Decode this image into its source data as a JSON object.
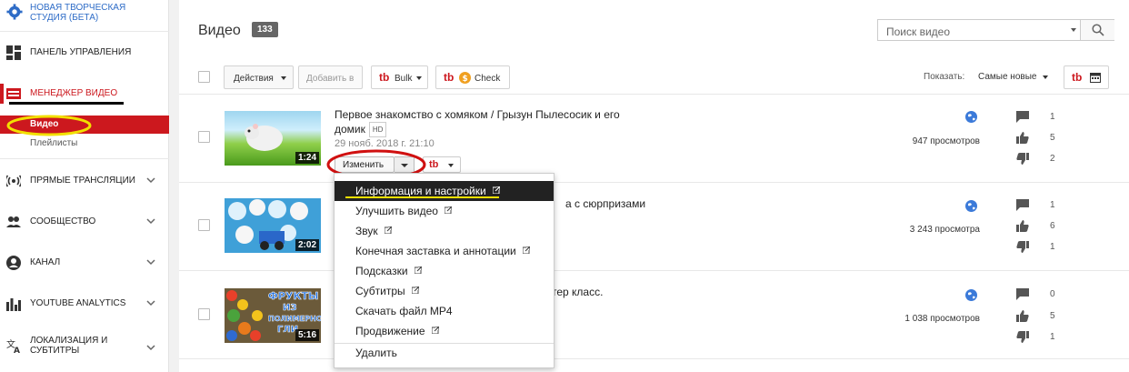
{
  "sidebar": {
    "studio_line1": "НОВАЯ ТВОРЧЕСКАЯ",
    "studio_line2": "СТУДИЯ (БЕТА)",
    "items": [
      {
        "label": "ПАНЕЛЬ УПРАВЛЕНИЯ"
      },
      {
        "label": "МЕНЕДЖЕР ВИДЕО"
      },
      {
        "label": "ПРЯМЫЕ ТРАНСЛЯЦИИ"
      },
      {
        "label": "СООБЩЕСТВО"
      },
      {
        "label": "КАНАЛ"
      },
      {
        "label": "YOUTUBE ANALYTICS"
      },
      {
        "label_line1": "ЛОКАЛИЗАЦИЯ И",
        "label_line2": "СУБТИТРЫ"
      }
    ],
    "sub_active": "Видео",
    "sub_other": "Плейлисты"
  },
  "header": {
    "title": "Видео",
    "count": "133",
    "search_placeholder": "Поиск видео"
  },
  "toolbar": {
    "actions": "Действия",
    "add_to": "Добавить в",
    "bulk": "Bulk",
    "check": "Check",
    "show_label": "Показать:",
    "sort_value": "Самые новые"
  },
  "videos": [
    {
      "title_line1": "Первое знакомство с хомяком / Грызун Пылесосик и его",
      "title_line2": "домик",
      "hd": "HD",
      "date": "29 нояб. 2018 г. 21:10",
      "duration": "1:24",
      "views": "947 просмотров",
      "comments": "1",
      "likes": "5",
      "dislikes": "2"
    },
    {
      "title_tail": "а с сюрпризами",
      "duration": "2:02",
      "views": "3 243 просмотра",
      "comments": "1",
      "likes": "6",
      "dislikes": "1"
    },
    {
      "title_tail": "тер класс.",
      "duration": "5:16",
      "thumb_text_1": "ФРУКТЫ",
      "thumb_text_2": "ИЗ",
      "thumb_text_3": "ПОЛИМЕРНОЙ",
      "thumb_text_4": "ГЛИ",
      "views": "1 038 просмотров",
      "comments": "0",
      "likes": "5",
      "dislikes": "1"
    }
  ],
  "edit": {
    "label": "Изменить"
  },
  "menu": {
    "items": [
      "Информация и настройки",
      "Улучшить видео",
      "Звук",
      "Конечная заставка и аннотации",
      "Подсказки",
      "Субтитры",
      "Скачать файл MP4",
      "Продвижение",
      "Удалить"
    ]
  },
  "colors": {
    "accent_red": "#cc181e",
    "link_blue": "#2e6cc7",
    "annotation_yellow": "#f2e000",
    "annotation_red": "#d01010"
  }
}
